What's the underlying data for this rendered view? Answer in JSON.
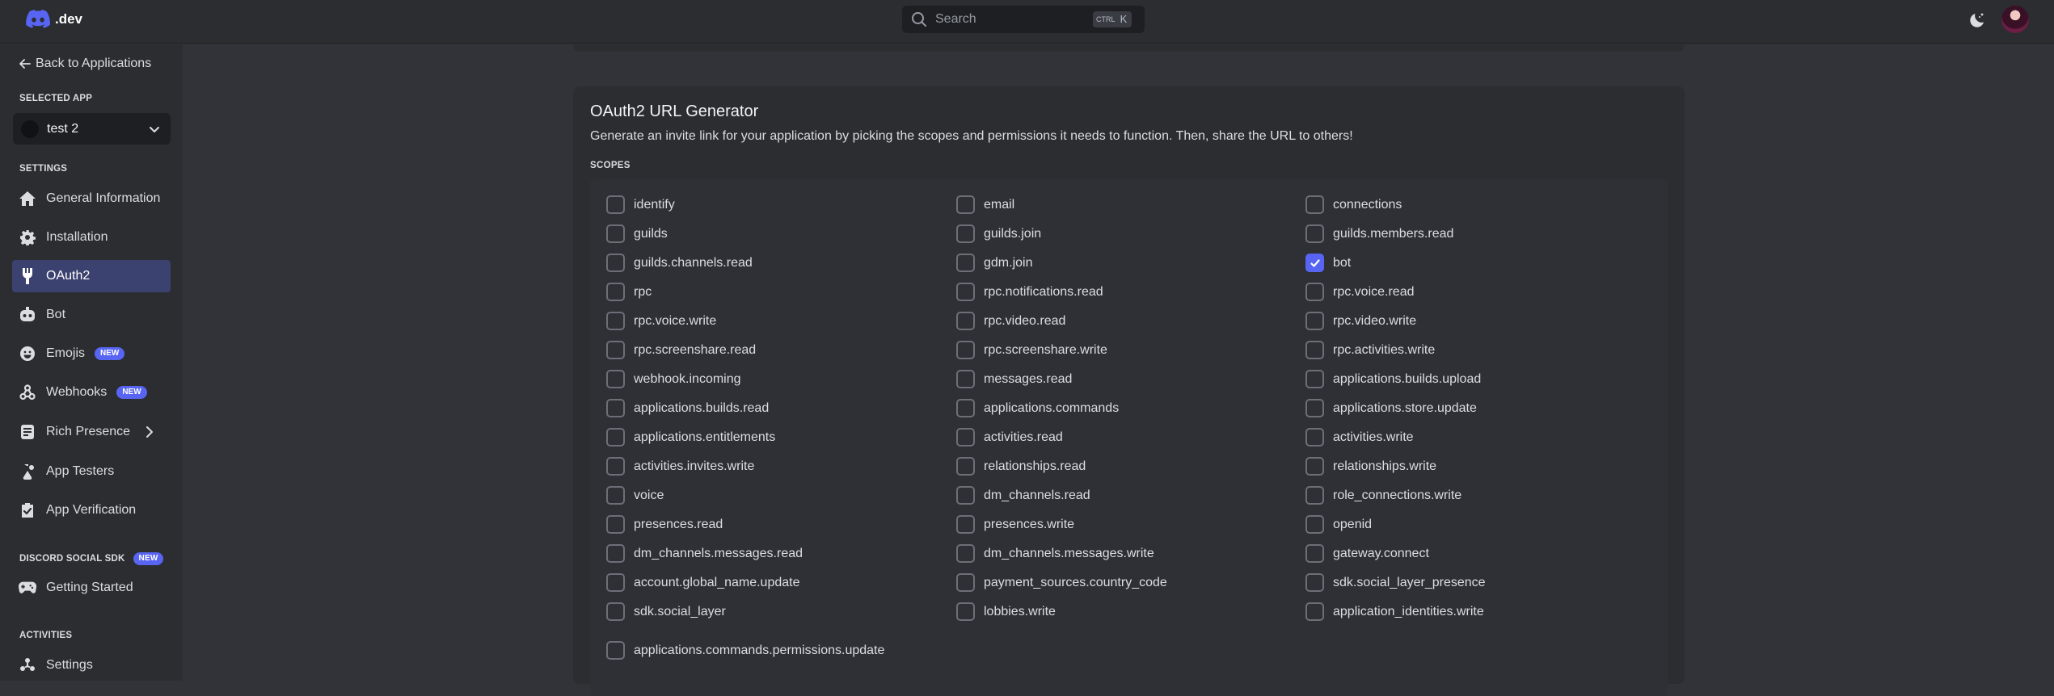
{
  "header": {
    "logo_text": ".dev",
    "search_placeholder": "Search",
    "shortcut_modifier": "CTRL",
    "shortcut_key": "K"
  },
  "sidebar": {
    "back_label": "Back to Applications",
    "selected_app_heading": "SELECTED APP",
    "selected_app_name": "test 2",
    "settings_heading": "SETTINGS",
    "items": [
      {
        "label": "General Information",
        "icon": "home-icon"
      },
      {
        "label": "Installation",
        "icon": "gear-icon"
      },
      {
        "label": "OAuth2",
        "icon": "wrench-icon",
        "active": true
      },
      {
        "label": "Bot",
        "icon": "bot-icon"
      },
      {
        "label": "Emojis",
        "icon": "emoji-icon",
        "badge": "NEW"
      },
      {
        "label": "Webhooks",
        "icon": "webhook-icon",
        "badge": "NEW"
      },
      {
        "label": "Rich Presence",
        "icon": "document-icon"
      },
      {
        "label": "App Testers",
        "icon": "testers-icon"
      },
      {
        "label": "App Verification",
        "icon": "verified-icon"
      }
    ],
    "sdk_heading": "DISCORD SOCIAL SDK",
    "sdk_badge": "NEW",
    "sdk_item": {
      "label": "Getting Started",
      "icon": "controller-icon"
    },
    "activities_heading": "ACTIVITIES",
    "activities_item": {
      "label": "Settings",
      "icon": "activities-settings-icon"
    }
  },
  "generator": {
    "title": "OAuth2 URL Generator",
    "description": "Generate an invite link for your application by picking the scopes and permissions it needs to function. Then, share the URL to others!",
    "scopes_heading": "SCOPES",
    "scopes": [
      {
        "label": "identify",
        "checked": false
      },
      {
        "label": "email",
        "checked": false
      },
      {
        "label": "connections",
        "checked": false
      },
      {
        "label": "guilds",
        "checked": false
      },
      {
        "label": "guilds.join",
        "checked": false
      },
      {
        "label": "guilds.members.read",
        "checked": false
      },
      {
        "label": "guilds.channels.read",
        "checked": false
      },
      {
        "label": "gdm.join",
        "checked": false
      },
      {
        "label": "bot",
        "checked": true
      },
      {
        "label": "rpc",
        "checked": false
      },
      {
        "label": "rpc.notifications.read",
        "checked": false
      },
      {
        "label": "rpc.voice.read",
        "checked": false
      },
      {
        "label": "rpc.voice.write",
        "checked": false
      },
      {
        "label": "rpc.video.read",
        "checked": false
      },
      {
        "label": "rpc.video.write",
        "checked": false
      },
      {
        "label": "rpc.screenshare.read",
        "checked": false
      },
      {
        "label": "rpc.screenshare.write",
        "checked": false
      },
      {
        "label": "rpc.activities.write",
        "checked": false
      },
      {
        "label": "webhook.incoming",
        "checked": false
      },
      {
        "label": "messages.read",
        "checked": false
      },
      {
        "label": "applications.builds.upload",
        "checked": false
      },
      {
        "label": "applications.builds.read",
        "checked": false
      },
      {
        "label": "applications.commands",
        "checked": false
      },
      {
        "label": "applications.store.update",
        "checked": false
      },
      {
        "label": "applications.entitlements",
        "checked": false
      },
      {
        "label": "activities.read",
        "checked": false
      },
      {
        "label": "activities.write",
        "checked": false
      },
      {
        "label": "activities.invites.write",
        "checked": false
      },
      {
        "label": "relationships.read",
        "checked": false
      },
      {
        "label": "relationships.write",
        "checked": false
      },
      {
        "label": "voice",
        "checked": false
      },
      {
        "label": "dm_channels.read",
        "checked": false
      },
      {
        "label": "role_connections.write",
        "checked": false
      },
      {
        "label": "presences.read",
        "checked": false
      },
      {
        "label": "presences.write",
        "checked": false
      },
      {
        "label": "openid",
        "checked": false
      },
      {
        "label": "dm_channels.messages.read",
        "checked": false
      },
      {
        "label": "dm_channels.messages.write",
        "checked": false
      },
      {
        "label": "gateway.connect",
        "checked": false
      },
      {
        "label": "account.global_name.update",
        "checked": false
      },
      {
        "label": "payment_sources.country_code",
        "checked": false
      },
      {
        "label": "sdk.social_layer_presence",
        "checked": false
      },
      {
        "label": "sdk.social_layer",
        "checked": false
      },
      {
        "label": "lobbies.write",
        "checked": false
      },
      {
        "label": "application_identities.write",
        "checked": false
      },
      {
        "label": "applications.commands.permissions.update",
        "checked": false
      }
    ]
  },
  "colors": {
    "accent": "#5865f2",
    "sidebar_active": "#3c4270",
    "background": "#323339",
    "panel": "#2b2d31"
  }
}
